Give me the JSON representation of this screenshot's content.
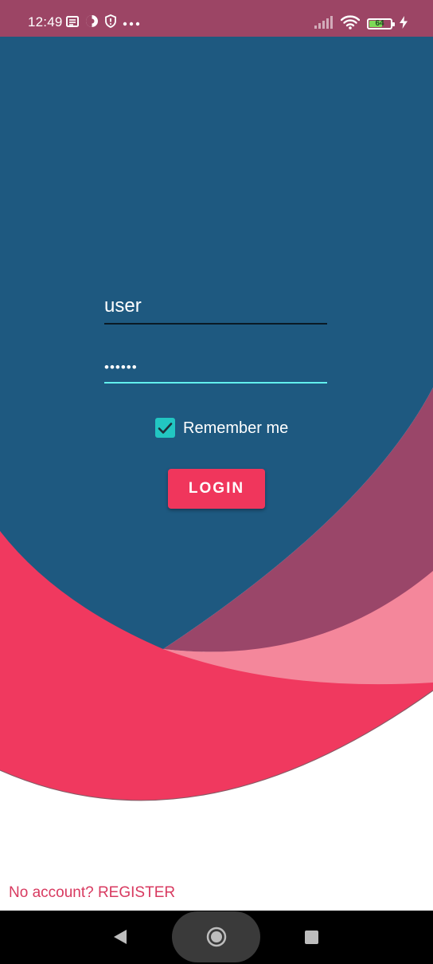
{
  "status_bar": {
    "time": "12:49",
    "battery_level": "64",
    "battery_percent": 64,
    "left_icons": [
      "notification-icon",
      "data-saver-icon",
      "shield-icon",
      "more-dots-icon"
    ],
    "right_icons": [
      "signal-icon",
      "wifi-icon",
      "battery-icon",
      "charging-icon"
    ]
  },
  "login_form": {
    "username_value": "user",
    "password_value": "••••••",
    "remember_label": "Remember me",
    "remember_checked": true,
    "login_button_label": "LOGIN"
  },
  "footer": {
    "register_text": "No account? REGISTER"
  },
  "navigation_bar": {
    "buttons": [
      "back-icon",
      "home-icon",
      "recents-icon"
    ]
  },
  "colors": {
    "status_bar_bg": "#9c4565",
    "dark_blue": "#1e5980",
    "mauve_wave": "#9a4669",
    "pink_wave": "#f4879b",
    "red_wave": "#f0395f",
    "accent_teal": "#22c6c2",
    "underline_active": "#62f0ee",
    "button_red": "#f0365c",
    "link_red": "#d83a60"
  }
}
